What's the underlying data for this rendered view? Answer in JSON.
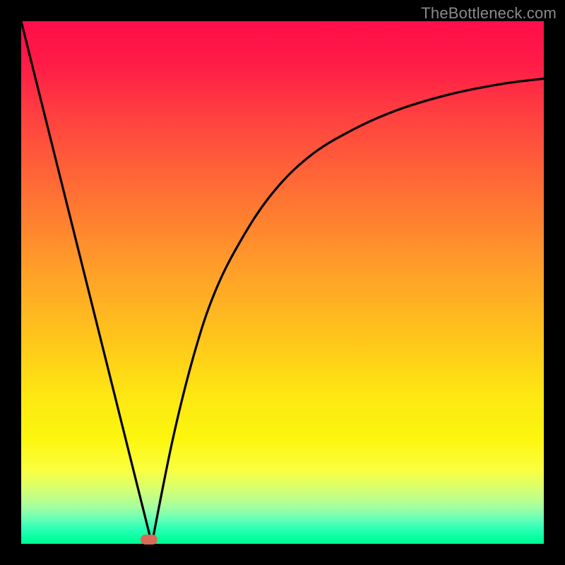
{
  "attribution": "TheBottleneck.com",
  "colors": {
    "page_bg": "#000000",
    "gradient_top": "#ff0e49",
    "gradient_bottom": "#00ff90",
    "curve": "#000000",
    "marker": "#d96a58",
    "attribution_text": "#8a8a8a"
  },
  "chart_data": {
    "type": "line",
    "title": "",
    "xlabel": "",
    "ylabel": "",
    "xlim": [
      0,
      100
    ],
    "ylim": [
      0,
      100
    ],
    "grid": false,
    "legend": null,
    "annotations": [
      "TheBottleneck.com"
    ],
    "series": [
      {
        "name": "left-leg",
        "x": [
          0,
          25
        ],
        "y": [
          100,
          0
        ]
      },
      {
        "name": "right-curve",
        "x": [
          25,
          29,
          33,
          37,
          42,
          48,
          55,
          63,
          72,
          82,
          92,
          100
        ],
        "y": [
          0,
          20,
          36,
          48,
          58,
          67,
          74,
          79,
          83,
          86,
          88,
          89
        ]
      }
    ],
    "marker": {
      "x": 24.5,
      "y": 0.8
    }
  }
}
